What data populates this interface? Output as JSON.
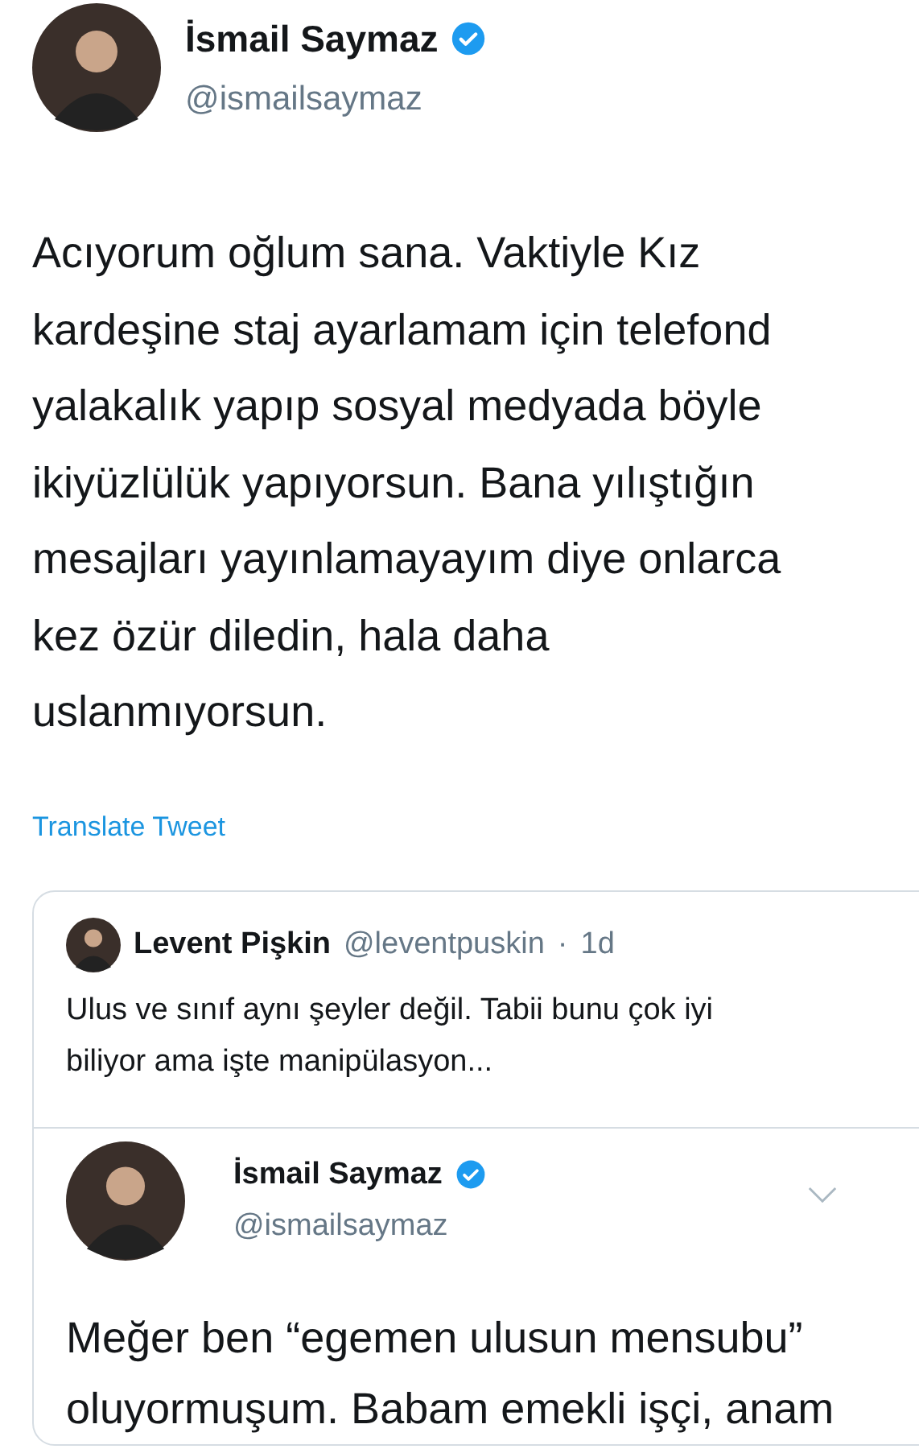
{
  "tweet": {
    "author": {
      "name": "İsmail Saymaz",
      "handle": "@ismailsaymaz",
      "verified": true
    },
    "text_lines": [
      "Acıyorum oğlum sana. Vaktiyle Kız",
      "kardeşine staj ayarlamam için telefond",
      "yalakalık yapıp sosyal medyada böyle",
      "ikiyüzlülük yapıyorsun. Bana yılıştığın",
      "mesajları yayınlamayayım diye onlarca",
      "kez özür diledin, hala daha",
      "uslanmıyorsun."
    ],
    "translate_link": "Translate Tweet",
    "quoted": {
      "author": {
        "name": "Levent Pişkin",
        "handle": "@leventpuskin",
        "separator": "·",
        "time": "1d"
      },
      "text_lines": [
        "Ulus ve sınıf aynı şeyler değil. Tabii bunu çok iyi",
        "biliyor ama işte manipülasyon..."
      ],
      "inner": {
        "author": {
          "name": "İsmail Saymaz",
          "handle": "@ismailsaymaz",
          "verified": true
        },
        "text_lines": [
          "Meğer ben “egemen ulusun mensubu”",
          "oluyormuşum. Babam emekli işçi, anam"
        ]
      }
    }
  }
}
